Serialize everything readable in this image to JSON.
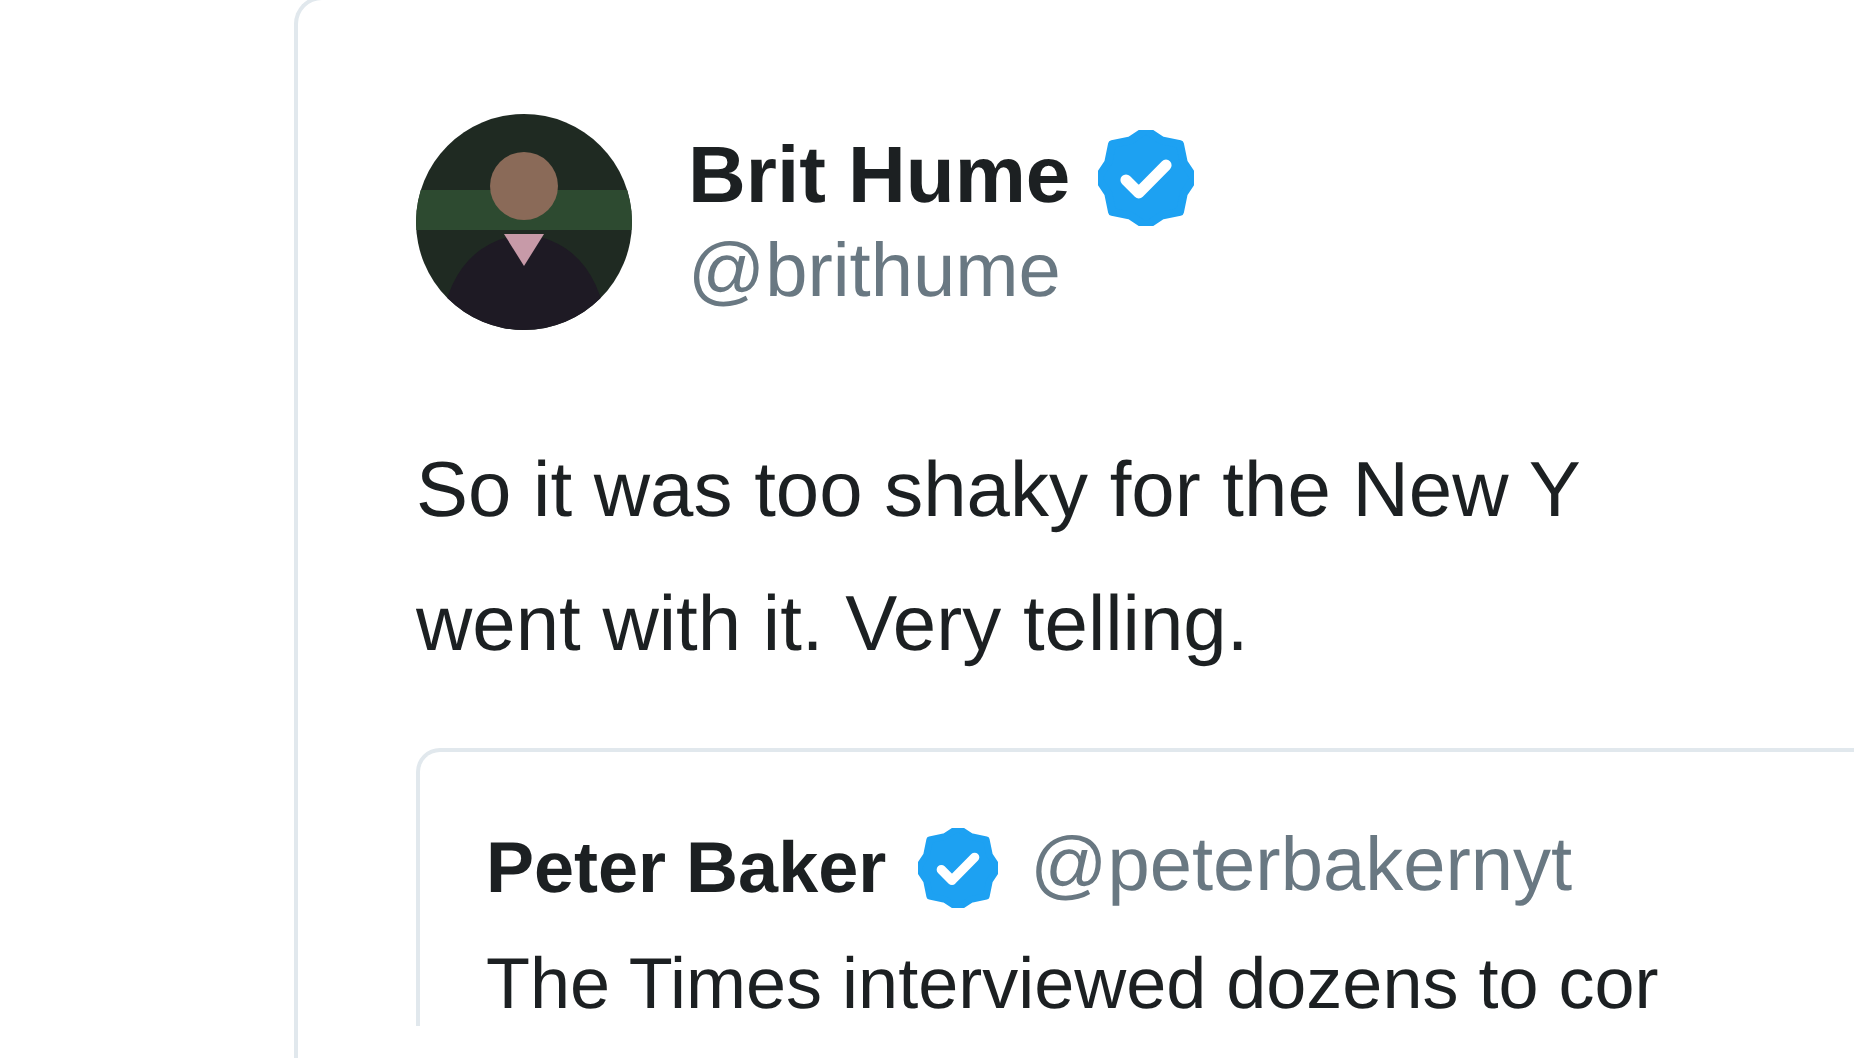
{
  "tweet": {
    "author": {
      "name": "Brit Hume",
      "verified": true,
      "handle": "@brithume"
    },
    "text_lines": [
      "So it was too shaky for the New Y",
      "went with it. Very telling."
    ],
    "quoted_tweet": {
      "author": {
        "name": "Peter Baker",
        "verified": true,
        "handle": "@peterbakernyt"
      },
      "text": "The Times interviewed dozens to cor"
    }
  }
}
